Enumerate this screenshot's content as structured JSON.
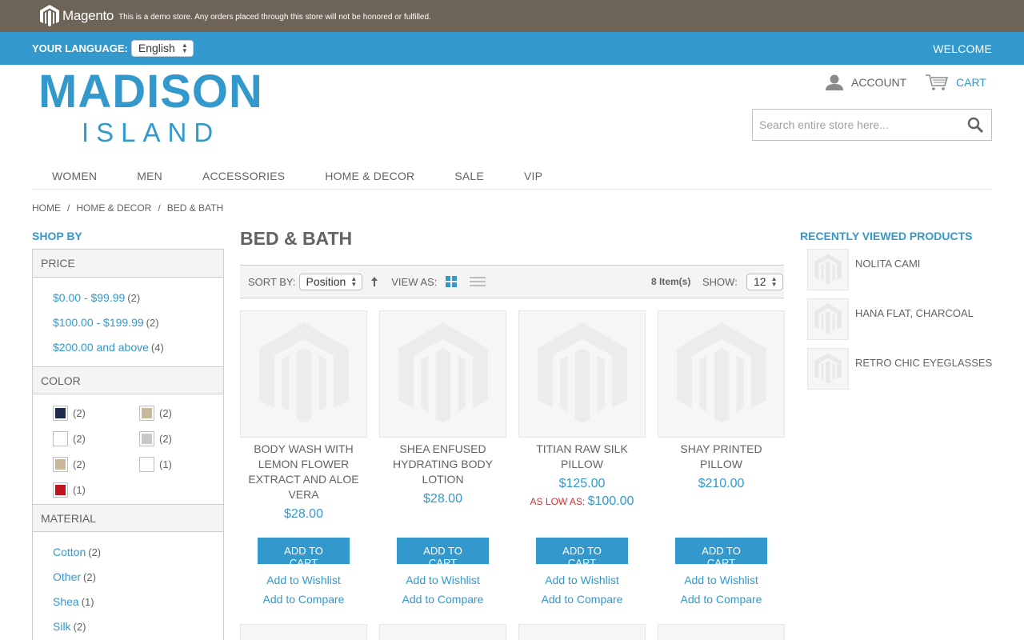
{
  "demo_notice": {
    "brand": "Magento",
    "text": "This is a demo store. Any orders placed through this store will not be honored or fulfilled."
  },
  "language_bar": {
    "label": "YOUR LANGUAGE:",
    "selected": "English",
    "welcome": "WELCOME"
  },
  "logo": {
    "line1": "MADISON",
    "line2": "ISLAND"
  },
  "header": {
    "account": "ACCOUNT",
    "cart": "CART",
    "search_placeholder": "Search entire store here..."
  },
  "nav": [
    "WOMEN",
    "MEN",
    "ACCESSORIES",
    "HOME & DECOR",
    "SALE",
    "VIP"
  ],
  "breadcrumb": [
    "HOME",
    "HOME & DECOR",
    "BED & BATH"
  ],
  "sidebar": {
    "title": "SHOP BY",
    "price": {
      "title": "PRICE",
      "options": [
        {
          "label": "$0.00 - $99.99",
          "count": "(2)"
        },
        {
          "label": "$100.00 - $199.99",
          "count": "(2)"
        },
        {
          "label": "$200.00 and above",
          "count": "(4)"
        }
      ]
    },
    "color": {
      "title": "COLOR",
      "swatches": [
        {
          "color": "#1e2a4e",
          "count": "(2)"
        },
        {
          "color": "#c9b99a",
          "count": "(2)"
        },
        {
          "color": "#ffffff",
          "count": "(2)"
        },
        {
          "color": "#c8c8c8",
          "count": "(2)"
        },
        {
          "color": "#c8b898",
          "count": "(2)"
        },
        {
          "color": "#ffffff",
          "count": "(1)"
        },
        {
          "color": "#c0161e",
          "count": "(1)"
        }
      ]
    },
    "material": {
      "title": "MATERIAL",
      "options": [
        {
          "label": "Cotton",
          "count": "(2)"
        },
        {
          "label": "Other",
          "count": "(2)"
        },
        {
          "label": "Shea",
          "count": "(1)"
        },
        {
          "label": "Silk",
          "count": "(2)"
        }
      ]
    }
  },
  "main": {
    "title": "BED & BATH",
    "toolbar": {
      "sort_label": "SORT BY:",
      "sort_value": "Position",
      "view_label": "VIEW AS:",
      "items": "8 Item(s)",
      "show_label": "SHOW:",
      "show_value": "12"
    },
    "products": [
      {
        "name": "BODY WASH WITH LEMON FLOWER EXTRACT AND ALOE VERA",
        "price": "$28.00",
        "low_label": "",
        "low_value": ""
      },
      {
        "name": "SHEA ENFUSED HYDRATING BODY LOTION",
        "price": "$28.00",
        "low_label": "",
        "low_value": ""
      },
      {
        "name": "TITIAN RAW SILK PILLOW",
        "price": "$125.00",
        "low_label": "AS LOW AS:",
        "low_value": "$100.00"
      },
      {
        "name": "SHAY PRINTED PILLOW",
        "price": "$210.00",
        "low_label": "",
        "low_value": ""
      }
    ],
    "add_to_cart": "ADD TO CART",
    "add_to_wishlist": "Add to Wishlist",
    "add_to_compare": "Add to Compare"
  },
  "recent": {
    "title": "RECENTLY VIEWED PRODUCTS",
    "items": [
      "NOLITA CAMI",
      "HANA FLAT, CHARCOAL",
      "RETRO CHIC EYEGLASSES"
    ]
  },
  "colors": {
    "accent": "#3399cc",
    "demo_bar": "#6e6357",
    "text": "#636363",
    "sale": "#cc3333"
  }
}
